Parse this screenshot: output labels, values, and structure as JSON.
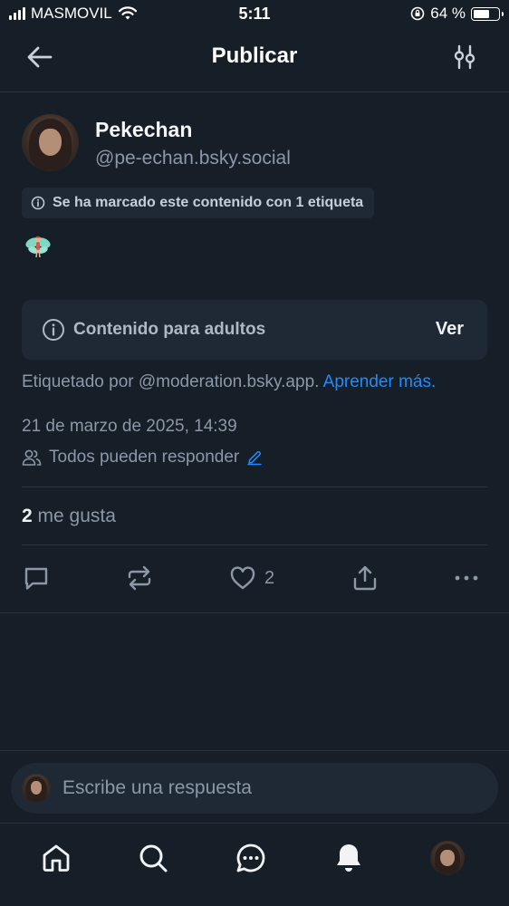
{
  "status_bar": {
    "carrier": "MASMOVIL",
    "time": "5:11",
    "battery_percent": "64 %",
    "battery_level": 0.64
  },
  "header": {
    "title": "Publicar",
    "back_icon": "arrow-left-icon",
    "settings_icon": "sliders-icon"
  },
  "post": {
    "author_name": "Pekechan",
    "author_handle": "@pe-echan.bsky.social",
    "label_notice": "Se ha marcado este contenido con 1 etiqueta",
    "emoji": "fairy-emoji",
    "content_warning": {
      "text": "Contenido para adultos",
      "action_label": "Ver"
    },
    "tagged_by_text": "Etiquetado por @moderation.bsky.app.",
    "learn_more_link": "Aprender más.",
    "date": "21 de marzo de 2025, 14:39",
    "reply_permission": "Todos pueden responder",
    "likes_count": "2",
    "likes_label": "me gusta",
    "action_like_count": "2"
  },
  "composer": {
    "placeholder": "Escribe una respuesta"
  },
  "tabbar": {
    "items": [
      "home-icon",
      "search-icon",
      "chat-icon",
      "notifications-icon",
      "profile-avatar"
    ]
  },
  "colors": {
    "background": "#161e27",
    "surface": "#1f2935",
    "muted_text": "#8a98a8",
    "link": "#208bfe"
  }
}
